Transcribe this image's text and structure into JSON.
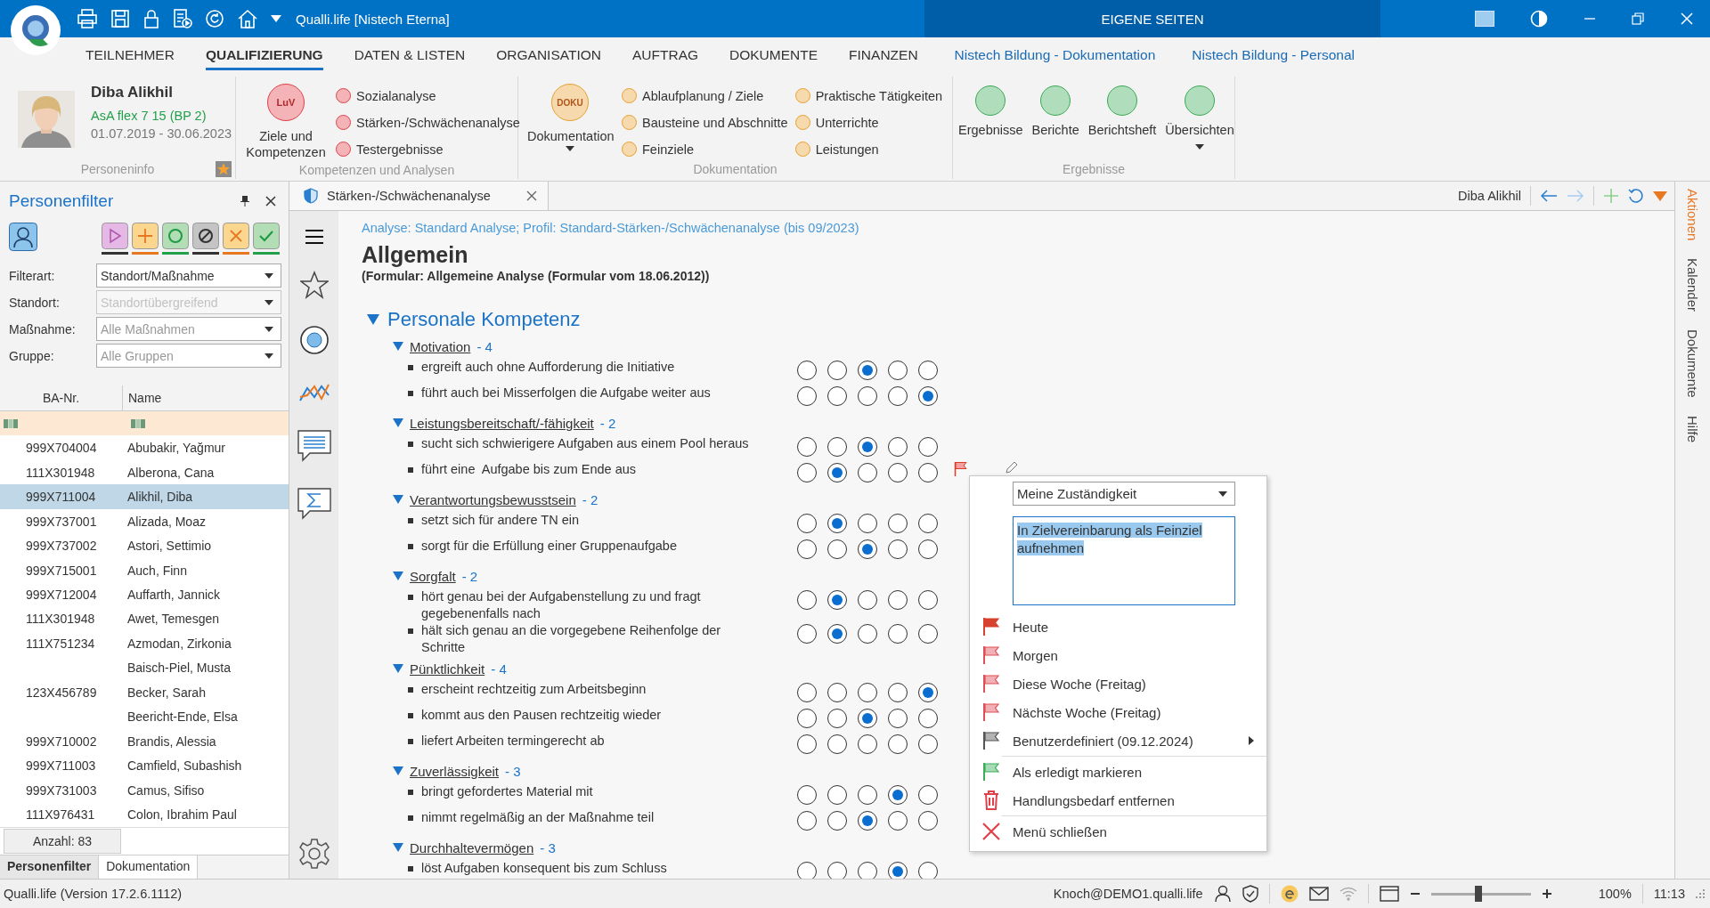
{
  "window": {
    "title": "Qualli.life [Nistech Eterna]",
    "center_title": "EIGENE SEITEN"
  },
  "menu_tabs": [
    {
      "label": "TEILNEHMER",
      "kind": "tab",
      "selected": false
    },
    {
      "label": "QUALIFIZIERUNG",
      "kind": "tab",
      "selected": true
    },
    {
      "label": "DATEN & LISTEN",
      "kind": "tab",
      "selected": false
    },
    {
      "label": "ORGANISATION",
      "kind": "tab",
      "selected": false
    },
    {
      "label": "AUFTRAG",
      "kind": "tab",
      "selected": false
    },
    {
      "label": "DOKUMENTE",
      "kind": "tab",
      "selected": false
    },
    {
      "label": "FINANZEN",
      "kind": "tab",
      "selected": false
    },
    {
      "label": "Nistech Bildung - Dokumentation",
      "kind": "link",
      "selected": false
    },
    {
      "label": "Nistech Bildung - Personal",
      "kind": "link",
      "selected": false
    }
  ],
  "person": {
    "name": "Diba Alikhil",
    "program": "AsA flex 7 15 (BP 2)",
    "period": "01.07.2019 - 30.06.2023",
    "group_label": "Personeninfo"
  },
  "ribbon_groups": [
    {
      "kind": "main_and_list",
      "label": "Kompetenzen und Analysen",
      "color": "#e0404a",
      "main": {
        "badge": "LuV",
        "label": "Ziele und Kompetenzen",
        "dropdown": false
      },
      "columns": [
        [
          "Sozialanalyse",
          "Stärken-/Schwächenanalyse",
          "Testergebnisse"
        ]
      ]
    },
    {
      "kind": "main_and_list",
      "label": "Dokumentation",
      "color": "#e8a030",
      "main": {
        "badge": "DOKU",
        "label": "Dokumentation",
        "dropdown": true
      },
      "columns": [
        [
          "Ablaufplanung / Ziele",
          "Bausteine und Abschnitte",
          "Feinziele"
        ],
        [
          "Praktische Tätigkeiten",
          "Unterrichte",
          "Leistungen"
        ]
      ]
    },
    {
      "kind": "buttons",
      "label": "Ergebnisse",
      "color": "#3aaa55",
      "buttons": [
        {
          "label": "Ergebnisse",
          "dropdown": false
        },
        {
          "label": "Berichte",
          "dropdown": false
        },
        {
          "label": "Berichtsheft",
          "dropdown": false
        },
        {
          "label": "Übersichten",
          "dropdown": true
        }
      ]
    }
  ],
  "filter_panel": {
    "title": "Personenfilter",
    "buttons": [
      {
        "kind": "play",
        "color": "#333333"
      },
      {
        "kind": "plus",
        "color": "#e87722"
      },
      {
        "kind": "circle",
        "color": "#22a04b"
      },
      {
        "kind": "blocked",
        "color": "#333333"
      },
      {
        "kind": "cross",
        "color": "#e87722"
      },
      {
        "kind": "check",
        "color": "#22a04b"
      }
    ],
    "fields": [
      {
        "label": "Filterart:",
        "value": "Standort/Maßnahme",
        "disabled": false
      },
      {
        "label": "Standort:",
        "placeholder": "Standortübergreifend",
        "disabled": true
      },
      {
        "label": "Maßnahme:",
        "placeholder": "Alle Maßnahmen",
        "disabled": false
      },
      {
        "label": "Gruppe:",
        "placeholder": "Alle Gruppen",
        "disabled": false
      }
    ],
    "columns": [
      "BA-Nr.",
      "Name"
    ],
    "rows": [
      {
        "ba": "999X704004",
        "name": "Abubakir, Yağmur",
        "selected": false
      },
      {
        "ba": "111X301948",
        "name": "Alberona, Cana",
        "selected": false
      },
      {
        "ba": "999X711004",
        "name": "Alikhil, Diba",
        "selected": true
      },
      {
        "ba": "999X737001",
        "name": "Alizada, Moaz",
        "selected": false
      },
      {
        "ba": "999X737002",
        "name": "Astori, Settimio",
        "selected": false
      },
      {
        "ba": "999X715001",
        "name": "Auch, Finn",
        "selected": false
      },
      {
        "ba": "999X712004",
        "name": "Auffarth, Jannick",
        "selected": false
      },
      {
        "ba": "111X301948",
        "name": "Awet, Temesgen",
        "selected": false
      },
      {
        "ba": "111X751234",
        "name": "Azmodan, Zirkonia",
        "selected": false
      },
      {
        "name": "Baisch-Piel, Musta",
        "selected": false
      },
      {
        "ba": "123X456789",
        "name": "Becker, Sarah",
        "selected": false
      },
      {
        "name": "Beericht-Ende, Elsa",
        "selected": false
      },
      {
        "ba": "999X710002",
        "name": "Brandis, Alessia",
        "selected": false
      },
      {
        "ba": "999X711003",
        "name": "Camfield, Subashish",
        "selected": false
      },
      {
        "ba": "999X731003",
        "name": "Camus, Sifiso",
        "selected": false
      },
      {
        "ba": "111X976431",
        "name": "Colon, Ibrahim Paul",
        "selected": false
      }
    ],
    "count": "Anzahl: 83",
    "bottom_tabs": [
      {
        "label": "Personenfilter",
        "selected": true
      },
      {
        "label": "Dokumentation",
        "selected": false
      }
    ]
  },
  "document_tab": {
    "label": "Stärken-/Schwächenanalyse",
    "person": "Diba Alikhil"
  },
  "right_tabs": [
    {
      "label": "Aktionen",
      "selected": true
    },
    {
      "label": "Kalender",
      "selected": false
    },
    {
      "label": "Dokumente",
      "selected": false
    },
    {
      "label": "Hilfe",
      "selected": false
    }
  ],
  "form": {
    "breadcrumb": "Analyse: Standard Analyse; Profil: Standard-Stärken-/Schwächenanalyse (bis 09/2023)",
    "title": "Allgemein",
    "subtitle": "(Formular: Allgemeine Analyse (Formular vom 18.06.2012))",
    "section": {
      "title": "Personale Kompetenz",
      "expanded": true,
      "categories": [
        {
          "name": "Motivation",
          "score": "- 4",
          "expanded": true,
          "items": [
            {
              "text": "ergreift auch ohne Aufforderung die Initiative",
              "flagged": false,
              "ratings": [
                {
                  "selected": false
                },
                {
                  "selected": false
                },
                {
                  "selected": true
                },
                {
                  "selected": false
                },
                {
                  "selected": false
                }
              ]
            },
            {
              "text": "führt auch bei Misserfolgen die Aufgabe weiter aus",
              "flagged": false,
              "ratings": [
                {
                  "selected": false
                },
                {
                  "selected": false
                },
                {
                  "selected": false
                },
                {
                  "selected": false
                },
                {
                  "selected": true
                }
              ]
            }
          ]
        },
        {
          "name": "Leistungsbereitschaft/-fähigkeit",
          "score": "- 2",
          "expanded": true,
          "items": [
            {
              "text": "sucht sich schwierigere Aufgaben aus einem Pool heraus",
              "flagged": false,
              "ratings": [
                {
                  "selected": false
                },
                {
                  "selected": false
                },
                {
                  "selected": true
                },
                {
                  "selected": false
                },
                {
                  "selected": false
                }
              ]
            },
            {
              "text": "führt eine  Aufgabe bis zum Ende aus",
              "flagged": true,
              "ratings": [
                {
                  "selected": false
                },
                {
                  "selected": true
                },
                {
                  "selected": false
                },
                {
                  "selected": false
                },
                {
                  "selected": false
                }
              ]
            }
          ]
        },
        {
          "name": "Verantwortungsbewusstsein",
          "score": "- 2",
          "expanded": true,
          "items": [
            {
              "text": "setzt sich für andere TN ein",
              "flagged": false,
              "ratings": [
                {
                  "selected": false
                },
                {
                  "selected": true
                },
                {
                  "selected": false
                },
                {
                  "selected": false
                },
                {
                  "selected": false
                }
              ]
            },
            {
              "text": "sorgt für die Erfüllung einer Gruppenaufgabe",
              "flagged": false,
              "ratings": [
                {
                  "selected": false
                },
                {
                  "selected": false
                },
                {
                  "selected": true
                },
                {
                  "selected": false
                },
                {
                  "selected": false
                }
              ]
            }
          ]
        },
        {
          "name": "Sorgfalt",
          "score": "- 2",
          "expanded": true,
          "items": [
            {
              "text": "hört genau bei der Aufgabenstellung zu und fragt gegebenenfalls nach",
              "flagged": false,
              "ratings": [
                {
                  "selected": false
                },
                {
                  "selected": true
                },
                {
                  "selected": false
                },
                {
                  "selected": false
                },
                {
                  "selected": false
                }
              ]
            },
            {
              "text": "hält sich genau an die vorgegebene Reihenfolge der Schritte",
              "flagged": false,
              "ratings": [
                {
                  "selected": false
                },
                {
                  "selected": true
                },
                {
                  "selected": false
                },
                {
                  "selected": false
                },
                {
                  "selected": false
                }
              ]
            }
          ]
        },
        {
          "name": "Pünktlichkeit",
          "score": "- 4",
          "expanded": true,
          "items": [
            {
              "text": "erscheint rechtzeitig zum Arbeitsbeginn",
              "flagged": false,
              "ratings": [
                {
                  "selected": false
                },
                {
                  "selected": false
                },
                {
                  "selected": false
                },
                {
                  "selected": false
                },
                {
                  "selected": true
                }
              ]
            },
            {
              "text": "kommt aus den Pausen rechtzeitig wieder",
              "flagged": false,
              "ratings": [
                {
                  "selected": false
                },
                {
                  "selected": false
                },
                {
                  "selected": true
                },
                {
                  "selected": false
                },
                {
                  "selected": false
                }
              ]
            },
            {
              "text": "liefert Arbeiten termingerecht ab",
              "flagged": false,
              "ratings": [
                {
                  "selected": false
                },
                {
                  "selected": false
                },
                {
                  "selected": false
                },
                {
                  "selected": false
                },
                {
                  "selected": false
                }
              ]
            }
          ]
        },
        {
          "name": "Zuverlässigkeit",
          "score": "- 3",
          "expanded": true,
          "items": [
            {
              "text": "bringt gefordertes Material mit",
              "flagged": false,
              "ratings": [
                {
                  "selected": false
                },
                {
                  "selected": false
                },
                {
                  "selected": false
                },
                {
                  "selected": true
                },
                {
                  "selected": false
                }
              ]
            },
            {
              "text": "nimmt regelmäßig an der Maßnahme teil",
              "flagged": false,
              "ratings": [
                {
                  "selected": false
                },
                {
                  "selected": false
                },
                {
                  "selected": true
                },
                {
                  "selected": false
                },
                {
                  "selected": false
                }
              ]
            }
          ]
        },
        {
          "name": "Durchhaltevermögen",
          "score": "- 3",
          "expanded": true,
          "items": [
            {
              "text": "löst Aufgaben konsequent bis zum Schluss",
              "flagged": false,
              "ratings": [
                {
                  "selected": false
                },
                {
                  "selected": false
                },
                {
                  "selected": false
                },
                {
                  "selected": true
                },
                {
                  "selected": false
                }
              ]
            }
          ]
        }
      ]
    }
  },
  "context_menu": {
    "responsibility": "Meine Zuständigkeit",
    "note": "In Zielvereinbarung als Feinziel aufnehmen",
    "item_groups": [
      [
        {
          "kind": "flag",
          "label": "Heute",
          "color": "#d8402f",
          "filled": true,
          "submenu": false
        },
        {
          "kind": "flag",
          "label": "Morgen",
          "color": "#e0505a",
          "filled": false,
          "submenu": false
        },
        {
          "kind": "flag",
          "label": "Diese Woche (Freitag)",
          "color": "#e0505a",
          "filled": false,
          "submenu": false
        },
        {
          "kind": "flag",
          "label": "Nächste Woche (Freitag)",
          "color": "#e0505a",
          "filled": false,
          "submenu": false
        },
        {
          "kind": "flag",
          "label": "Benutzerdefiniert (09.12.2024)",
          "color": "#555555",
          "filled": false,
          "submenu": true
        }
      ],
      [
        {
          "kind": "flag",
          "label": "Als erledigt markieren",
          "color": "#3cae5a",
          "filled": false,
          "submenu": false
        },
        {
          "kind": "trash",
          "label": "Handlungsbedarf entfernen",
          "color": "#e0404a",
          "submenu": false
        }
      ],
      [
        {
          "kind": "close",
          "label": "Menü schließen",
          "color": "#e0404a",
          "submenu": false
        }
      ]
    ]
  },
  "status_bar": {
    "version": "Qualli.life (Version 17.2.6.1112)",
    "user": "Knoch@DEMO1.qualli.life",
    "zoom": {
      "level": 0.48
    },
    "zoom_text": "100%",
    "time": "11:13"
  }
}
